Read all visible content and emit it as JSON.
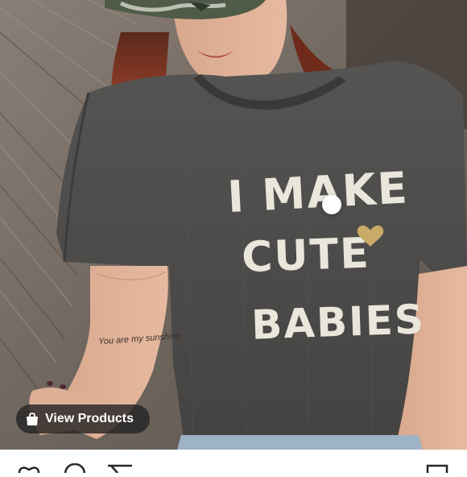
{
  "post": {
    "shirt_text": {
      "line1": "I MAKE",
      "line2": "CUTE",
      "line3": "BABIES"
    },
    "tattoo_text": "You are my sunshine",
    "shopping": {
      "view_products_label": "View Products",
      "tag_count": 1
    }
  },
  "action_bar": {
    "icons": [
      "heart-icon",
      "comment-icon",
      "share-icon",
      "bookmark-icon"
    ]
  },
  "colors": {
    "shirt": "#4a4a48",
    "hair": "#9b3a22",
    "pill_background": "#262626",
    "print": "#e9e6dc"
  }
}
